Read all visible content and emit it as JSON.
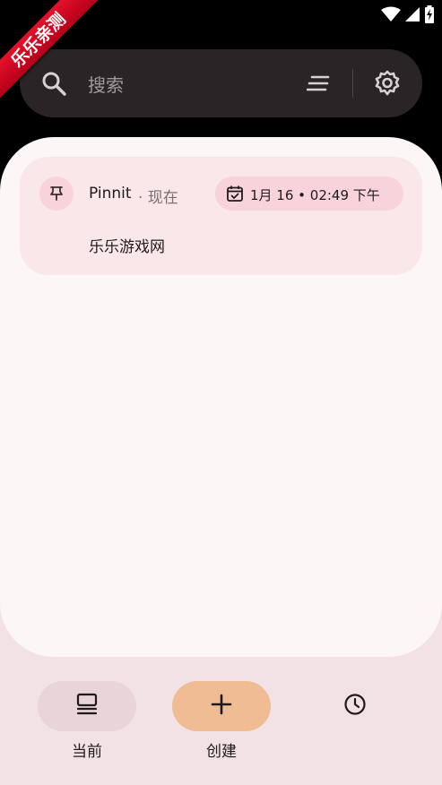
{
  "status_bar": {
    "icons": [
      "wifi-icon",
      "signal-icon",
      "battery-charging-icon"
    ]
  },
  "watermark": {
    "text": "乐乐亲测"
  },
  "search": {
    "placeholder": "搜索",
    "icons": [
      "search-icon",
      "sort-icon",
      "gear-icon"
    ]
  },
  "notification": {
    "app_name": "Pinnit",
    "time_ago": "· 现在",
    "date_chip": "1月 16 • 02:49 下午",
    "body": "乐乐游戏网",
    "icons": [
      "pin-icon",
      "calendar-check-icon"
    ]
  },
  "nav": {
    "items": [
      {
        "label": "当前",
        "icon": "stack-icon",
        "active": true
      },
      {
        "label": "创建",
        "icon": "plus-icon",
        "active": false
      },
      {
        "label": "",
        "icon": "history-clock-icon",
        "active": false
      }
    ]
  },
  "colors": {
    "search_bg": "#2b2426",
    "panel_bg": "#fdf6f6",
    "card_bg": "#fae7ea",
    "chip_bg": "#f8d3dc",
    "nav_active_bg": "#e9d4d9",
    "create_bg": "#efbc94",
    "ribbon": "#d4001f"
  }
}
